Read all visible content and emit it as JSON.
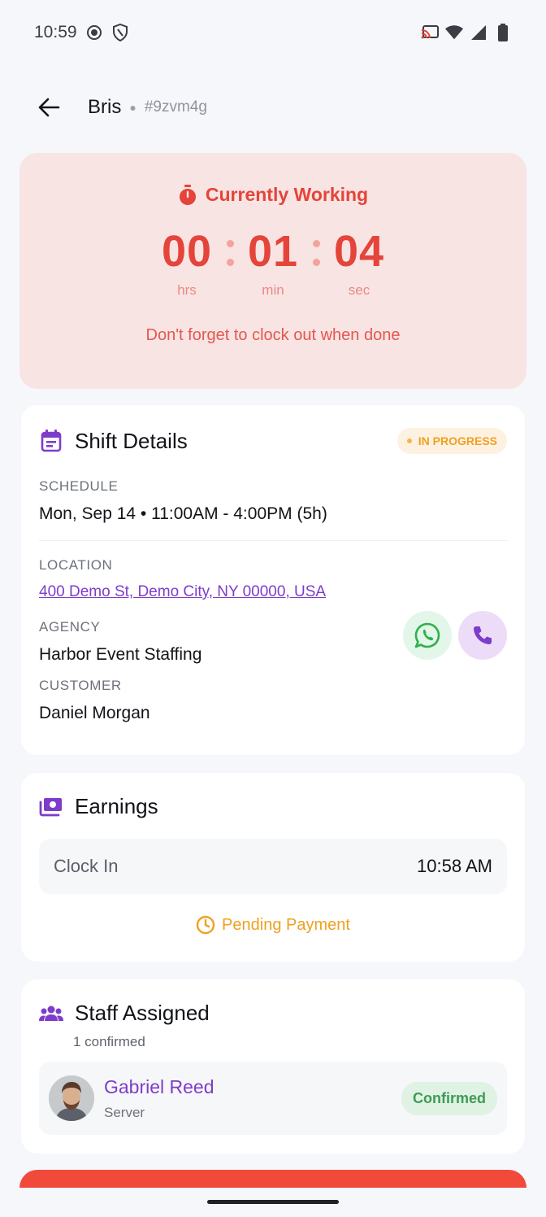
{
  "status_bar": {
    "time": "10:59",
    "icons": [
      "record-icon",
      "shield-icon",
      "cast-icon",
      "wifi-icon",
      "signal-icon",
      "battery-icon"
    ]
  },
  "header": {
    "title": "Bris",
    "id": "#9zvm4g"
  },
  "working": {
    "status_label": "Currently Working",
    "timer": {
      "hours": "00",
      "hours_label": "hrs",
      "minutes": "01",
      "minutes_label": "min",
      "seconds": "04",
      "seconds_label": "sec"
    },
    "note": "Don't forget to clock out when done",
    "color": "#e4443a"
  },
  "shift": {
    "title": "Shift Details",
    "status": "IN PROGRESS",
    "schedule_label": "SCHEDULE",
    "schedule_value": "Mon, Sep 14 • 11:00AM - 4:00PM (5h)",
    "location_label": "LOCATION",
    "location_value": "400 Demo St, Demo City, NY 00000, USA",
    "agency_label": "AGENCY",
    "agency_value": "Harbor Event Staffing",
    "customer_label": "CUSTOMER",
    "customer_value": "Daniel Morgan"
  },
  "earnings": {
    "title": "Earnings",
    "clock_in_label": "Clock In",
    "clock_in_value": "10:58 AM",
    "payment_status": "Pending Payment"
  },
  "staff": {
    "title": "Staff Assigned",
    "subtitle": "1 confirmed",
    "members": [
      {
        "name": "Gabriel Reed",
        "role": "Server",
        "status": "Confirmed"
      }
    ]
  },
  "colors": {
    "accent": "#7e3ccb",
    "danger": "#f14a3a",
    "warning": "#f0a020",
    "success": "#3f9b55"
  }
}
